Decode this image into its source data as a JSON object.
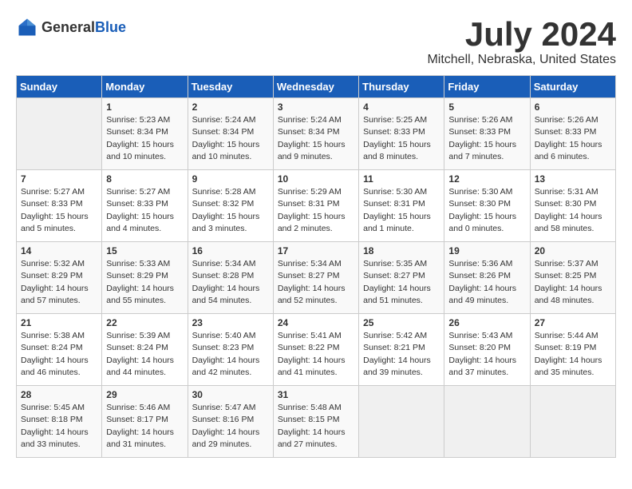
{
  "logo": {
    "general": "General",
    "blue": "Blue"
  },
  "title": "July 2024",
  "location": "Mitchell, Nebraska, United States",
  "weekdays": [
    "Sunday",
    "Monday",
    "Tuesday",
    "Wednesday",
    "Thursday",
    "Friday",
    "Saturday"
  ],
  "weeks": [
    [
      {
        "day": "",
        "empty": true
      },
      {
        "day": "1",
        "sunrise": "5:23 AM",
        "sunset": "8:34 PM",
        "daylight": "15 hours and 10 minutes."
      },
      {
        "day": "2",
        "sunrise": "5:24 AM",
        "sunset": "8:34 PM",
        "daylight": "15 hours and 10 minutes."
      },
      {
        "day": "3",
        "sunrise": "5:24 AM",
        "sunset": "8:34 PM",
        "daylight": "15 hours and 9 minutes."
      },
      {
        "day": "4",
        "sunrise": "5:25 AM",
        "sunset": "8:33 PM",
        "daylight": "15 hours and 8 minutes."
      },
      {
        "day": "5",
        "sunrise": "5:26 AM",
        "sunset": "8:33 PM",
        "daylight": "15 hours and 7 minutes."
      },
      {
        "day": "6",
        "sunrise": "5:26 AM",
        "sunset": "8:33 PM",
        "daylight": "15 hours and 6 minutes."
      }
    ],
    [
      {
        "day": "7",
        "sunrise": "5:27 AM",
        "sunset": "8:33 PM",
        "daylight": "15 hours and 5 minutes."
      },
      {
        "day": "8",
        "sunrise": "5:27 AM",
        "sunset": "8:33 PM",
        "daylight": "15 hours and 4 minutes."
      },
      {
        "day": "9",
        "sunrise": "5:28 AM",
        "sunset": "8:32 PM",
        "daylight": "15 hours and 3 minutes."
      },
      {
        "day": "10",
        "sunrise": "5:29 AM",
        "sunset": "8:31 PM",
        "daylight": "15 hours and 2 minutes."
      },
      {
        "day": "11",
        "sunrise": "5:30 AM",
        "sunset": "8:31 PM",
        "daylight": "15 hours and 1 minute."
      },
      {
        "day": "12",
        "sunrise": "5:30 AM",
        "sunset": "8:30 PM",
        "daylight": "15 hours and 0 minutes."
      },
      {
        "day": "13",
        "sunrise": "5:31 AM",
        "sunset": "8:30 PM",
        "daylight": "14 hours and 58 minutes."
      }
    ],
    [
      {
        "day": "14",
        "sunrise": "5:32 AM",
        "sunset": "8:29 PM",
        "daylight": "14 hours and 57 minutes."
      },
      {
        "day": "15",
        "sunrise": "5:33 AM",
        "sunset": "8:29 PM",
        "daylight": "14 hours and 55 minutes."
      },
      {
        "day": "16",
        "sunrise": "5:34 AM",
        "sunset": "8:28 PM",
        "daylight": "14 hours and 54 minutes."
      },
      {
        "day": "17",
        "sunrise": "5:34 AM",
        "sunset": "8:27 PM",
        "daylight": "14 hours and 52 minutes."
      },
      {
        "day": "18",
        "sunrise": "5:35 AM",
        "sunset": "8:27 PM",
        "daylight": "14 hours and 51 minutes."
      },
      {
        "day": "19",
        "sunrise": "5:36 AM",
        "sunset": "8:26 PM",
        "daylight": "14 hours and 49 minutes."
      },
      {
        "day": "20",
        "sunrise": "5:37 AM",
        "sunset": "8:25 PM",
        "daylight": "14 hours and 48 minutes."
      }
    ],
    [
      {
        "day": "21",
        "sunrise": "5:38 AM",
        "sunset": "8:24 PM",
        "daylight": "14 hours and 46 minutes."
      },
      {
        "day": "22",
        "sunrise": "5:39 AM",
        "sunset": "8:24 PM",
        "daylight": "14 hours and 44 minutes."
      },
      {
        "day": "23",
        "sunrise": "5:40 AM",
        "sunset": "8:23 PM",
        "daylight": "14 hours and 42 minutes."
      },
      {
        "day": "24",
        "sunrise": "5:41 AM",
        "sunset": "8:22 PM",
        "daylight": "14 hours and 41 minutes."
      },
      {
        "day": "25",
        "sunrise": "5:42 AM",
        "sunset": "8:21 PM",
        "daylight": "14 hours and 39 minutes."
      },
      {
        "day": "26",
        "sunrise": "5:43 AM",
        "sunset": "8:20 PM",
        "daylight": "14 hours and 37 minutes."
      },
      {
        "day": "27",
        "sunrise": "5:44 AM",
        "sunset": "8:19 PM",
        "daylight": "14 hours and 35 minutes."
      }
    ],
    [
      {
        "day": "28",
        "sunrise": "5:45 AM",
        "sunset": "8:18 PM",
        "daylight": "14 hours and 33 minutes."
      },
      {
        "day": "29",
        "sunrise": "5:46 AM",
        "sunset": "8:17 PM",
        "daylight": "14 hours and 31 minutes."
      },
      {
        "day": "30",
        "sunrise": "5:47 AM",
        "sunset": "8:16 PM",
        "daylight": "14 hours and 29 minutes."
      },
      {
        "day": "31",
        "sunrise": "5:48 AM",
        "sunset": "8:15 PM",
        "daylight": "14 hours and 27 minutes."
      },
      {
        "day": "",
        "empty": true
      },
      {
        "day": "",
        "empty": true
      },
      {
        "day": "",
        "empty": true
      }
    ]
  ]
}
